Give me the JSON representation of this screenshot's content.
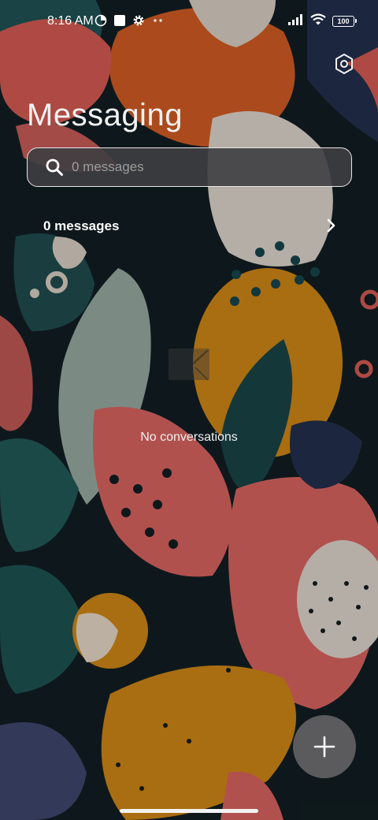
{
  "status_bar": {
    "time": "8:16 AM",
    "left_icons": [
      "data-saver-icon",
      "app-notification-icon",
      "gear-icon",
      "more-dots-icon"
    ],
    "right_icons": [
      "signal-icon",
      "wifi-icon",
      "battery-icon"
    ],
    "battery_level": "100"
  },
  "header": {
    "title": "Messaging",
    "settings_icon": "settings-icon"
  },
  "search": {
    "placeholder": "0 messages",
    "value": ""
  },
  "summary_row": {
    "label": "0 messages"
  },
  "empty_state": {
    "text": "No conversations",
    "icon": "empty-inbox-icon"
  },
  "fab": {
    "icon": "plus-icon"
  },
  "colors": {
    "background": "#10191c",
    "search_bg": "#3e3e42",
    "fab_bg": "#626264"
  }
}
